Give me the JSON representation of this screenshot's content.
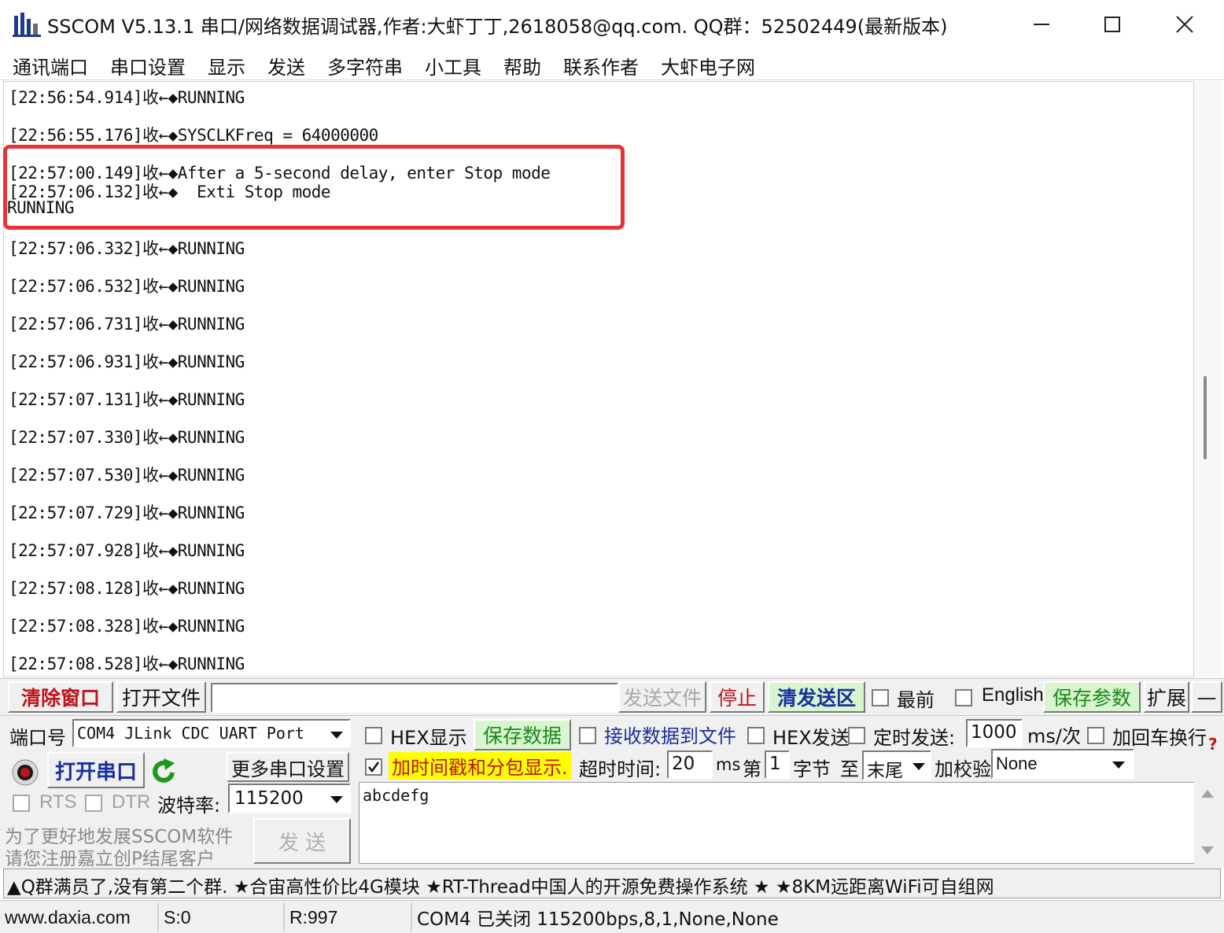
{
  "window": {
    "title": "SSCOM V5.13.1 串口/网络数据调试器,作者:大虾丁丁,2618058@qq.com. QQ群：52502449(最新版本)",
    "icons": [
      "app-icon",
      "minimize-icon",
      "maximize-icon",
      "close-icon"
    ]
  },
  "menu": [
    "通讯端口",
    "串口设置",
    "显示",
    "发送",
    "多字符串",
    "小工具",
    "帮助",
    "联系作者",
    "大虾电子网"
  ],
  "receive": {
    "lines": [
      "[22:56:54.914]收←◆RUNNING",
      "[22:56:55.176]收←◆SYSCLKFreq = 64000000",
      "[22:57:00.149]收←◆After a 5-second delay, enter Stop mode",
      "[22:57:06.132]收←◆  Exti Stop mode",
      "RUNNING",
      "[22:57:06.332]收←◆RUNNING",
      "[22:57:06.532]收←◆RUNNING",
      "[22:57:06.731]收←◆RUNNING",
      "[22:57:06.931]收←◆RUNNING",
      "[22:57:07.131]收←◆RUNNING",
      "[22:57:07.330]收←◆RUNNING",
      "[22:57:07.530]收←◆RUNNING",
      "[22:57:07.729]收←◆RUNNING",
      "[22:57:07.928]收←◆RUNNING",
      "[22:57:08.128]收←◆RUNNING",
      "[22:57:08.328]收←◆RUNNING",
      "[22:57:08.528]收←◆RUNNING"
    ],
    "highlight_color": "#e8323a"
  },
  "toolbar": {
    "clear_window": "清除窗口",
    "open_file": "打开文件",
    "file_path": "",
    "send_file": "发送文件",
    "stop": "停止",
    "clear_send": "清发送区",
    "topmost_label": "最前",
    "english_label": "English",
    "save_params": "保存参数",
    "expand": "扩展",
    "collapse": "—"
  },
  "port": {
    "port_label": "端口号",
    "port_value": "COM4 JLink CDC UART Port",
    "open_port": "打开串口",
    "more_settings": "更多串口设置",
    "rts": "RTS",
    "dtr": "DTR",
    "baud_label": "波特率:",
    "baud_value": "115200",
    "promo_line1": "为了更好地发展SSCOM软件",
    "promo_line2": "请您注册嘉立创P结尾客户",
    "send": "发  送"
  },
  "options": {
    "hex_display": "HEX显示",
    "save_data": "保存数据",
    "recv_to_file": "接收数据到文件",
    "hex_send": "HEX发送",
    "timed_send": "定时发送:",
    "interval_value": "1000",
    "interval_unit": "ms/次",
    "add_crlf": "加回车换行",
    "timestamp": "加时间戳和分包显示.",
    "timestamp_checked": true,
    "timeout_label": "超时时间:",
    "timeout_value": "20",
    "timeout_unit": "ms",
    "byte_prefix": "第",
    "byte_value": "1",
    "byte_unit": "字节",
    "to_label": "至",
    "end_value": "末尾",
    "checksum_label": "加校验",
    "checksum_value": "None"
  },
  "send_text": "abcdefg",
  "ad_text": "▲Q群满员了,没有第二个群. ★合宙高性价比4G模块 ★RT-Thread中国人的开源免费操作系统 ★ ★8KM远距离WiFi可自组网",
  "status": {
    "website": "www.daxia.com",
    "sent": "S:0",
    "received": "R:997",
    "port_state": "COM4 已关闭  115200bps,8,1,None,None"
  },
  "colors": {
    "red_label": "#c0141c",
    "green_label": "#1a8a1a",
    "blue_label": "#1a2fa0",
    "yellow_bg": "#ffff00",
    "green_bg": "#d8f5d0"
  }
}
